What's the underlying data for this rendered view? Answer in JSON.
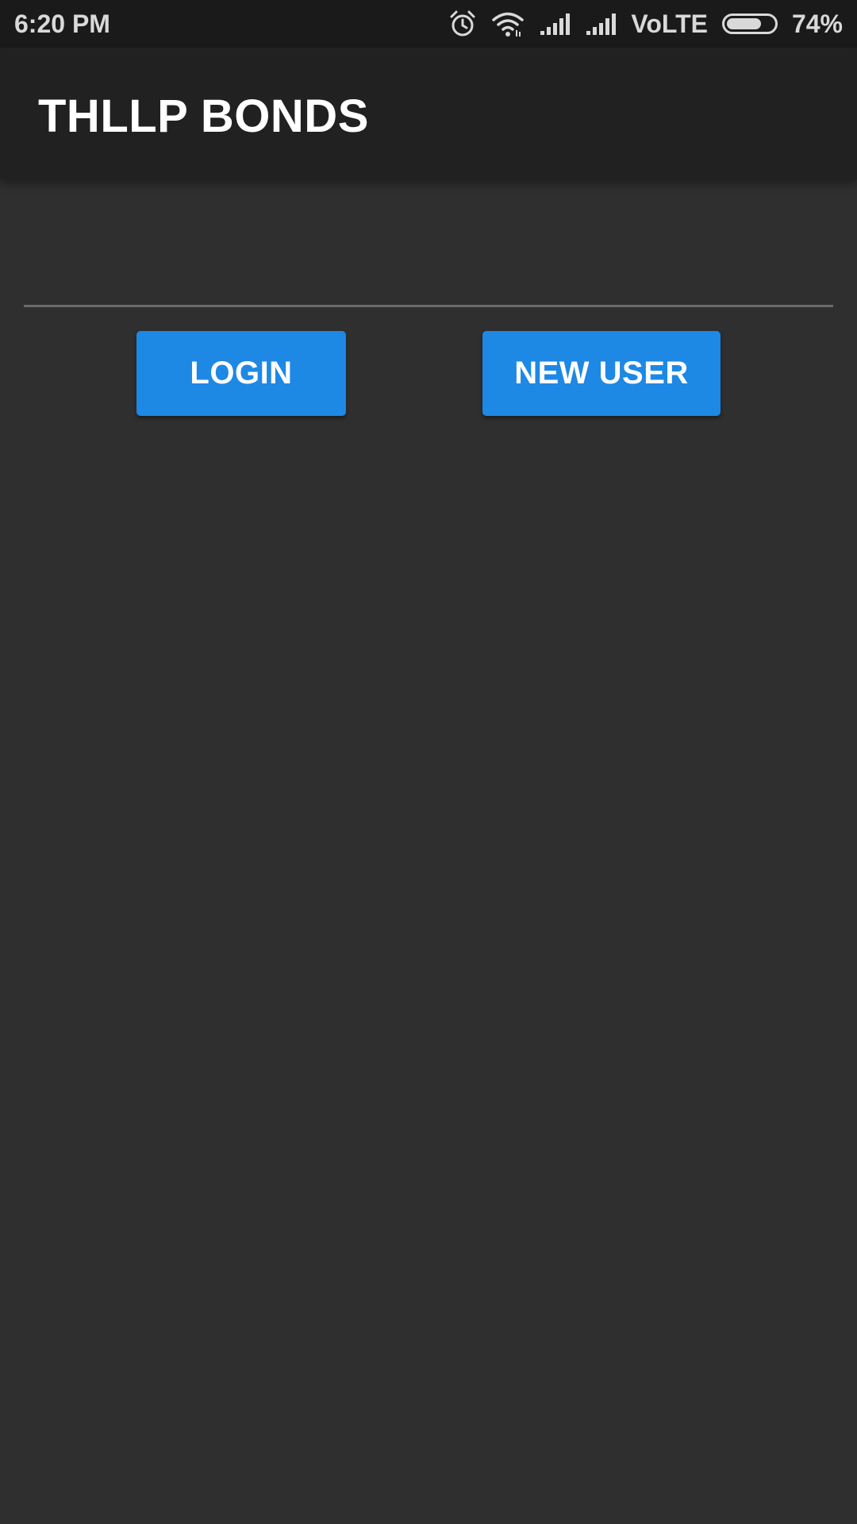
{
  "status_bar": {
    "time": "6:20 PM",
    "network_label": "VoLTE",
    "battery_percent_label": "74%",
    "battery_level": 0.74,
    "icons": [
      "alarm-icon",
      "wifi-icon",
      "signal-icon",
      "signal-icon"
    ]
  },
  "app_bar": {
    "title": "THLLP BONDS"
  },
  "actions": {
    "login_label": "LOGIN",
    "new_user_label": "NEW USER"
  },
  "colors": {
    "background": "#2f2f2f",
    "app_bar": "#212121",
    "status_bar": "#1a1a1a",
    "accent": "#1e88e5"
  }
}
